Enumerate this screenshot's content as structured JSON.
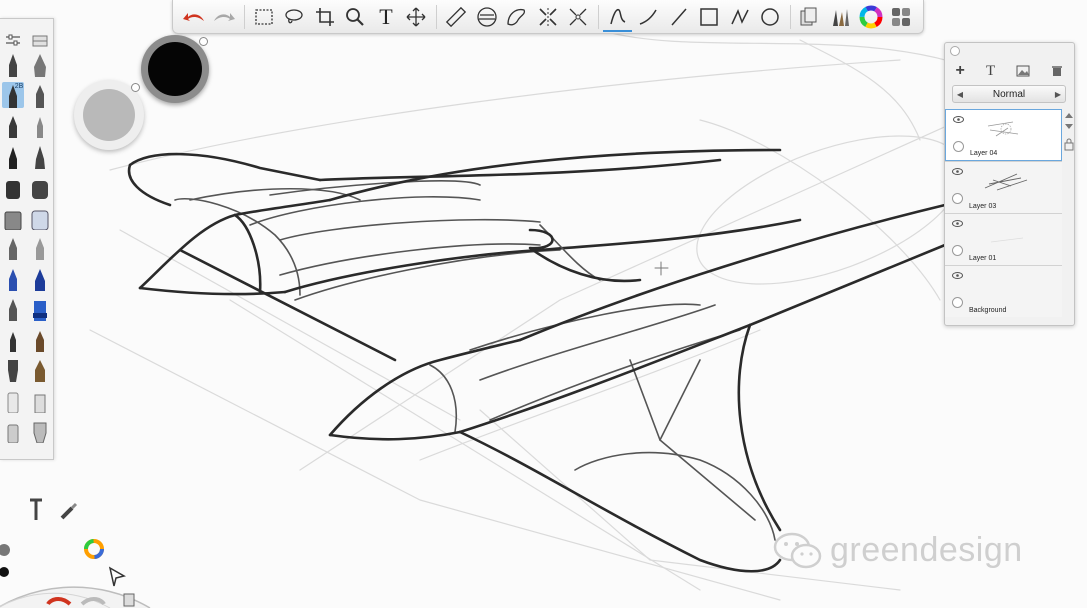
{
  "app": {
    "accent": "#3a8fd8",
    "undo_color": "#d0341f"
  },
  "toolbar": {
    "tools": [
      "undo-icon",
      "redo-icon",
      "rect-select-icon",
      "lasso-icon",
      "crop-icon",
      "zoom-icon",
      "text-icon",
      "transform-icon",
      "ruler-icon",
      "ellipse-guide-icon",
      "french-curve-icon",
      "symmetry-icon",
      "perspective-icon",
      "brush-stroke-icon",
      "steady-stroke-icon",
      "line-icon",
      "rectangle-icon",
      "polyline-icon",
      "ellipse-icon",
      "copic-library-icon",
      "brush-library-icon",
      "color-wheel-icon",
      "layer-editor-icon"
    ],
    "text_tool_label": "T"
  },
  "brushes": {
    "selected_label": "2B"
  },
  "colors": {
    "current_primary": "#050505",
    "current_secondary": "#b9b9b9"
  },
  "layers": {
    "blend_mode": "Normal",
    "items": [
      {
        "name": "Layer 04",
        "selected": true
      },
      {
        "name": "Layer 03",
        "selected": false
      },
      {
        "name": "Layer 01",
        "selected": false
      },
      {
        "name": "Background",
        "selected": false
      }
    ]
  },
  "watermark": {
    "text": "greendesign"
  }
}
